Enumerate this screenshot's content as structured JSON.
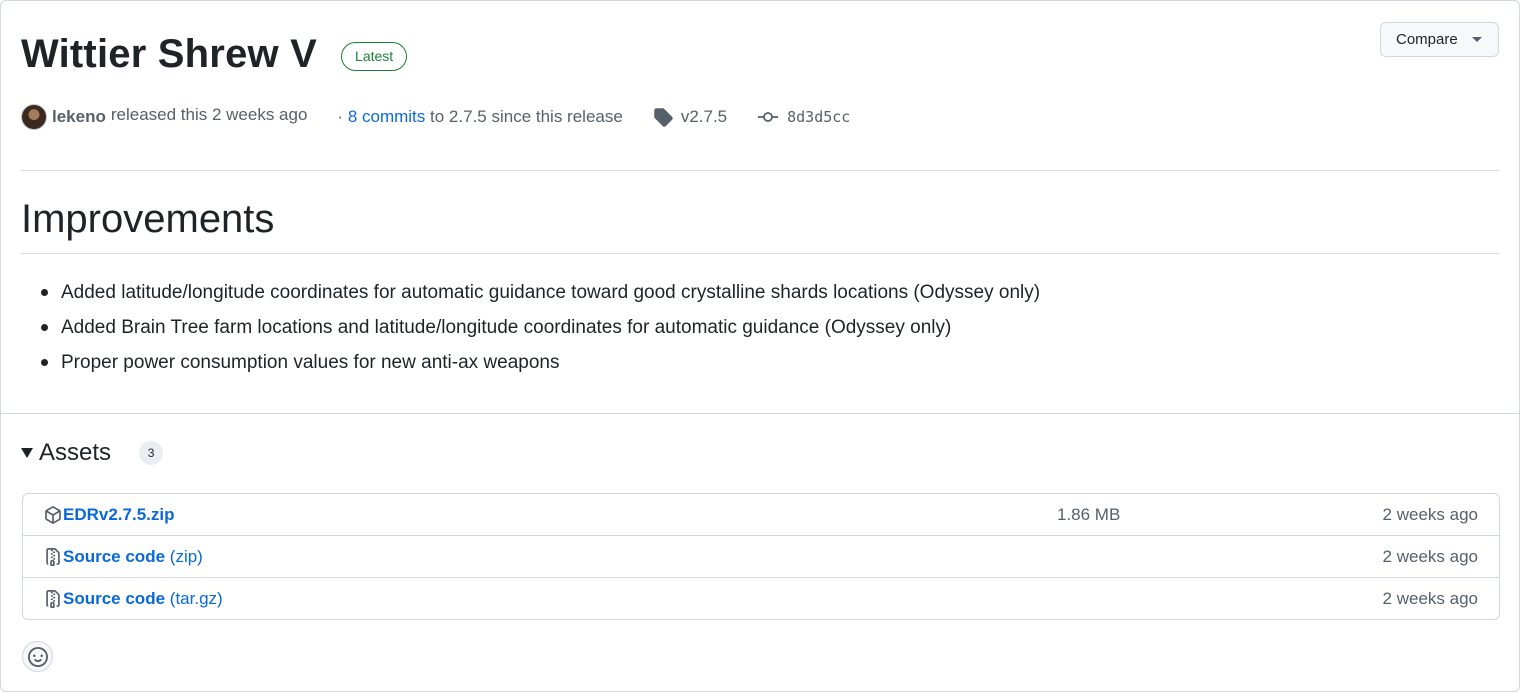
{
  "release": {
    "title": "Wittier Shrew V",
    "badge": "Latest",
    "compare_label": "Compare",
    "author": "lekeno",
    "released_text": "released this 2 weeks ago",
    "commits_prefix": "·",
    "commits_link": "8 commits",
    "commits_suffix": "to 2.7.5 since this release",
    "tag": "v2.7.5",
    "commit_sha": "8d3d5cc"
  },
  "notes": {
    "heading": "Improvements",
    "items": [
      "Added latitude/longitude coordinates for automatic guidance toward good crystalline shards locations (Odyssey only)",
      "Added Brain Tree farm locations and latitude/longitude coordinates for automatic guidance (Odyssey only)",
      "Proper power consumption values for new anti-ax weapons"
    ]
  },
  "assets": {
    "title": "Assets",
    "count": "3",
    "rows": [
      {
        "name": "EDRv2.7.5.zip",
        "suffix": "",
        "size": "1.86 MB",
        "date": "2 weeks ago",
        "icon": "package-icon"
      },
      {
        "name": "Source code",
        "suffix": "(zip)",
        "size": "",
        "date": "2 weeks ago",
        "icon": "file-zip-icon"
      },
      {
        "name": "Source code",
        "suffix": "(tar.gz)",
        "size": "",
        "date": "2 weeks ago",
        "icon": "file-zip-icon"
      }
    ]
  },
  "colors": {
    "link": "#0969da",
    "latest_badge": "#1a7f37",
    "muted_text": "#57606a",
    "border": "#d0d7de"
  }
}
